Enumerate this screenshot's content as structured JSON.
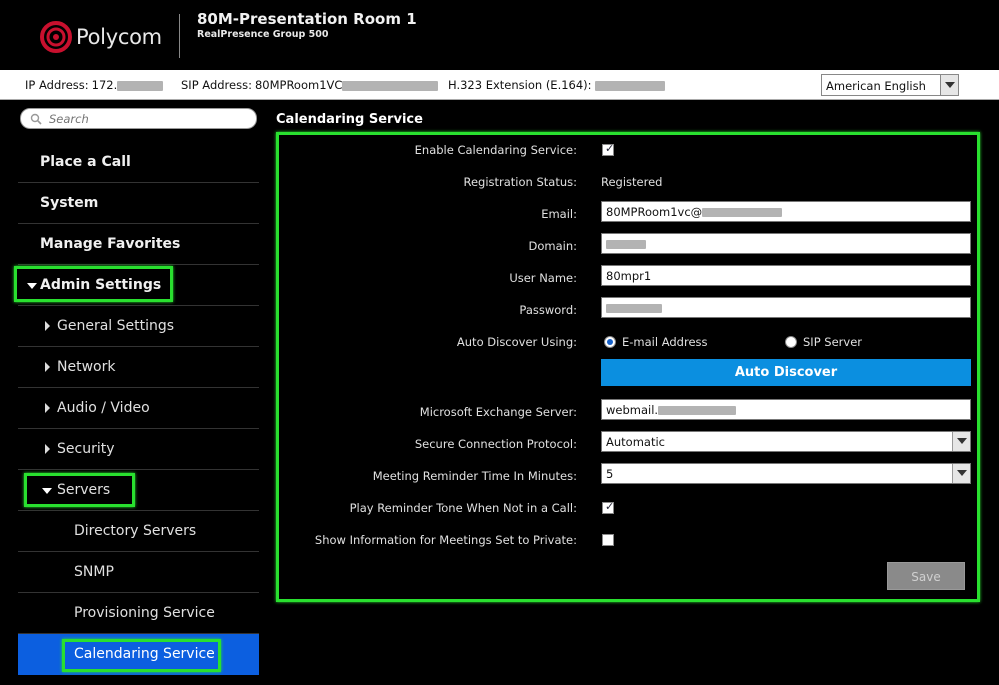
{
  "header": {
    "logo_text": "Polycom",
    "room_name": "80M-Presentation Room 1",
    "model": "RealPresence Group 500"
  },
  "infobar": {
    "ip_label": "IP Address:",
    "ip_value": "172.",
    "sip_label": "SIP Address:",
    "sip_value": "80MPRoom1VC",
    "h323_label": "H.323 Extension (E.164):",
    "language": "American English"
  },
  "sidebar": {
    "search_placeholder": "Search",
    "items": [
      {
        "label": "Place a Call"
      },
      {
        "label": "System"
      },
      {
        "label": "Manage Favorites"
      },
      {
        "label": "Admin Settings"
      },
      {
        "label": "General Settings"
      },
      {
        "label": "Network"
      },
      {
        "label": "Audio / Video"
      },
      {
        "label": "Security"
      },
      {
        "label": "Servers"
      },
      {
        "label": "Directory Servers"
      },
      {
        "label": "SNMP"
      },
      {
        "label": "Provisioning Service"
      },
      {
        "label": "Calendaring Service"
      }
    ]
  },
  "main": {
    "title": "Calendaring Service",
    "enable_label": "Enable Calendaring Service:",
    "enable_checked": true,
    "registration_label": "Registration Status:",
    "registration_value": "Registered",
    "email_label": "Email:",
    "email_value": "80MPRoom1vc@",
    "domain_label": "Domain:",
    "username_label": "User Name:",
    "username_value": "80mpr1",
    "password_label": "Password:",
    "auto_discover_label": "Auto Discover Using:",
    "radio_email": "E-mail Address",
    "radio_sip": "SIP Server",
    "auto_discover_button": "Auto Discover",
    "exchange_label": "Microsoft Exchange Server:",
    "exchange_value": "webmail.",
    "protocol_label": "Secure Connection Protocol:",
    "protocol_value": "Automatic",
    "reminder_label": "Meeting Reminder Time In Minutes:",
    "reminder_value": "5",
    "tone_label": "Play Reminder Tone When Not in a Call:",
    "tone_checked": true,
    "private_label": "Show Information for Meetings Set to Private:",
    "private_checked": false,
    "save_label": "Save"
  },
  "colors": {
    "highlight": "#29e02f",
    "active_nav": "#0c5fe0",
    "button_blue": "#0b8fe0"
  }
}
